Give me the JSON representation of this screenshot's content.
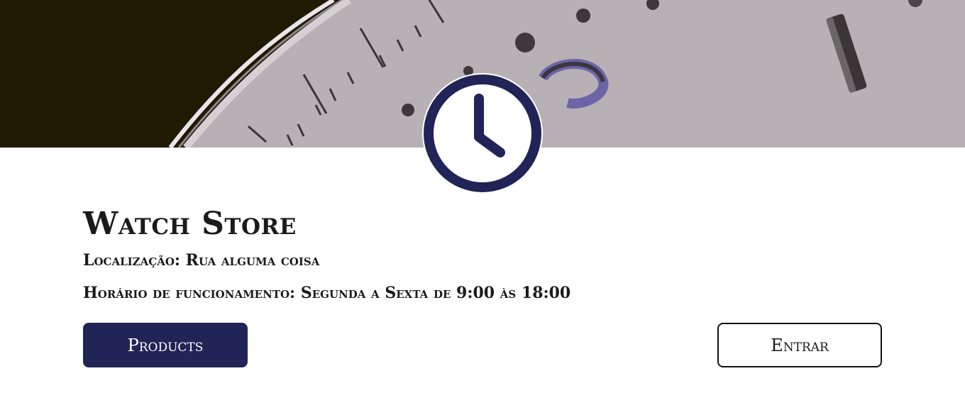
{
  "hero": {
    "image_icon": "watch-dial-photo",
    "badge_icon": "clock-icon",
    "accent_color": "#202456"
  },
  "store": {
    "title": "Watch Store",
    "location": "Localização: Rua alguma coisa",
    "hours": "Horário de funcionamento: Segunda a Sexta de 9:00 às 18:00"
  },
  "actions": {
    "products_label": "Products",
    "login_label": "Entrar"
  }
}
